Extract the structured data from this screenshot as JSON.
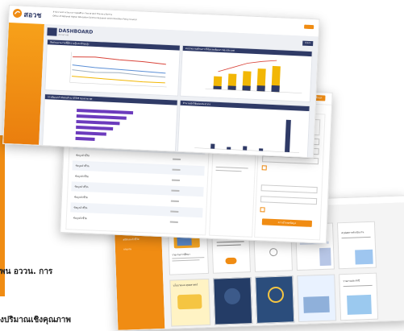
{
  "logo": {
    "text": "สอวช",
    "tagline_1": "สำนักงานสภานโยบายการอุดมศึกษา วิทยาศาสตร์ วิจัยและนวัตกรรม",
    "tagline_2": "Office of National Higher Education Science Research and Innovation Policy Council"
  },
  "dashboard": {
    "title": "DASHBOARD",
    "subtitle": "สถานการณ์",
    "panels": [
      {
        "title": "สัดส่วนแรงงานที่มีความรู้และทักษะสูง"
      },
      {
        "title": "งบประมาณด้านการวิจัยและพัฒนา ของประเทศ"
      },
      {
        "title": "การพัฒนากำลังคนด้าน STEM ของประเทศ"
      },
      {
        "title": "จำนวนนักวิจัยต่อประชากร"
      }
    ],
    "button": "ส่งออก"
  },
  "form_page": {
    "button": "ส่งข้อมูล",
    "header_text": "ข้อมูลรายงานตัวชี้วัด",
    "download_button": "ดาวน์โหลดข้อมูล",
    "table_rows": [
      "ข้อมูลตัวชี้วัด",
      "ข้อมูลตัวชี้วัด",
      "ข้อมูลตัวชี้วัด",
      "ข้อมูลตัวชี้วัด",
      "ข้อมูลตัวชี้วัด",
      "ข้อมูลตัวชี้วัด",
      "ข้อมูลตัวชี้วัด",
      "ข้อมูลตัวชี้วัด",
      "ข้อมูลตัวชี้วัด",
      "ข้อมูลตัวชี้วัด"
    ]
  },
  "reports_page": {
    "menu": [
      "หน้าหลัก",
      "สถิติและตัวชี้วัด",
      "รายงาน"
    ],
    "cards": [
      "รายงานการศึกษา",
      "",
      "Executive Summary",
      "สรุปผลการดำเนินงาน",
      "นโยบายและยุทธศาสตร์",
      "",
      "",
      "",
      "",
      "รายงานประจำปี"
    ]
  },
  "bottom_text": {
    "line1": "พน อววน. การ",
    "line2": "งปริมาณเชิงคุณภาพ"
  },
  "colors": {
    "orange": "#f08c13",
    "navy": "#2f3a66",
    "yellow": "#f2b705",
    "purple": "#6c3bbd"
  }
}
